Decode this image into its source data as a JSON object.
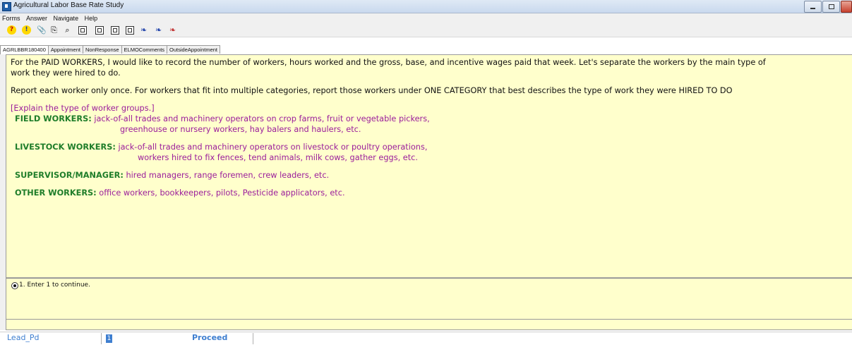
{
  "window": {
    "title": "Agricultural Labor Base Rate Study"
  },
  "menu": [
    "Forms",
    "Answer",
    "Navigate",
    "Help"
  ],
  "toolbar": [
    "help-icon",
    "info-icon",
    "attachment-icon",
    "copy-icon",
    "search-icon",
    "form1-icon",
    "form2-icon",
    "form3-icon",
    "form4-icon",
    "bird1-icon",
    "bird2-icon",
    "bird3-icon"
  ],
  "tabs": [
    "AGRLBBR180400",
    "Appointment",
    "NonResponse",
    "ELMOComments",
    "OutsideAppointment"
  ],
  "question": {
    "intro1": "For the PAID WORKERS, I would like to record the number of workers, hours worked and the gross, base, and incentive wages paid that week. Let's separate the workers by the main type of",
    "intro2": "work they were hired to do.",
    "report": "Report each worker only once. For workers that fit into multiple categories, report those workers under ONE CATEGORY that best describes the type of work they were HIRED TO DO",
    "explain": "[Explain the type of worker groups.]",
    "groups": [
      {
        "label": "FIELD WORKERS:",
        "text1": "jack-of-all trades and machinery operators on crop farms, fruit or vegetable pickers,",
        "text2": "greenhouse or nursery workers, hay balers and haulers, etc."
      },
      {
        "label": "LIVESTOCK WORKERS:",
        "text1": "jack-of-all trades and machinery operators on livestock or poultry operations,",
        "text2": "workers hired to fix fences, tend animals, milk cows, gather eggs, etc."
      },
      {
        "label": "SUPERVISOR/MANAGER:",
        "text1": "hired managers, range foremen, crew leaders, etc."
      },
      {
        "label": "OTHER WORKERS:",
        "text1": "office workers, bookkeepers, pilots, Pesticide applicators, etc."
      }
    ]
  },
  "answer": {
    "option": "1. Enter 1 to continue."
  },
  "status": {
    "field": "Lead_Pd",
    "value": "1",
    "action": "Proceed"
  }
}
